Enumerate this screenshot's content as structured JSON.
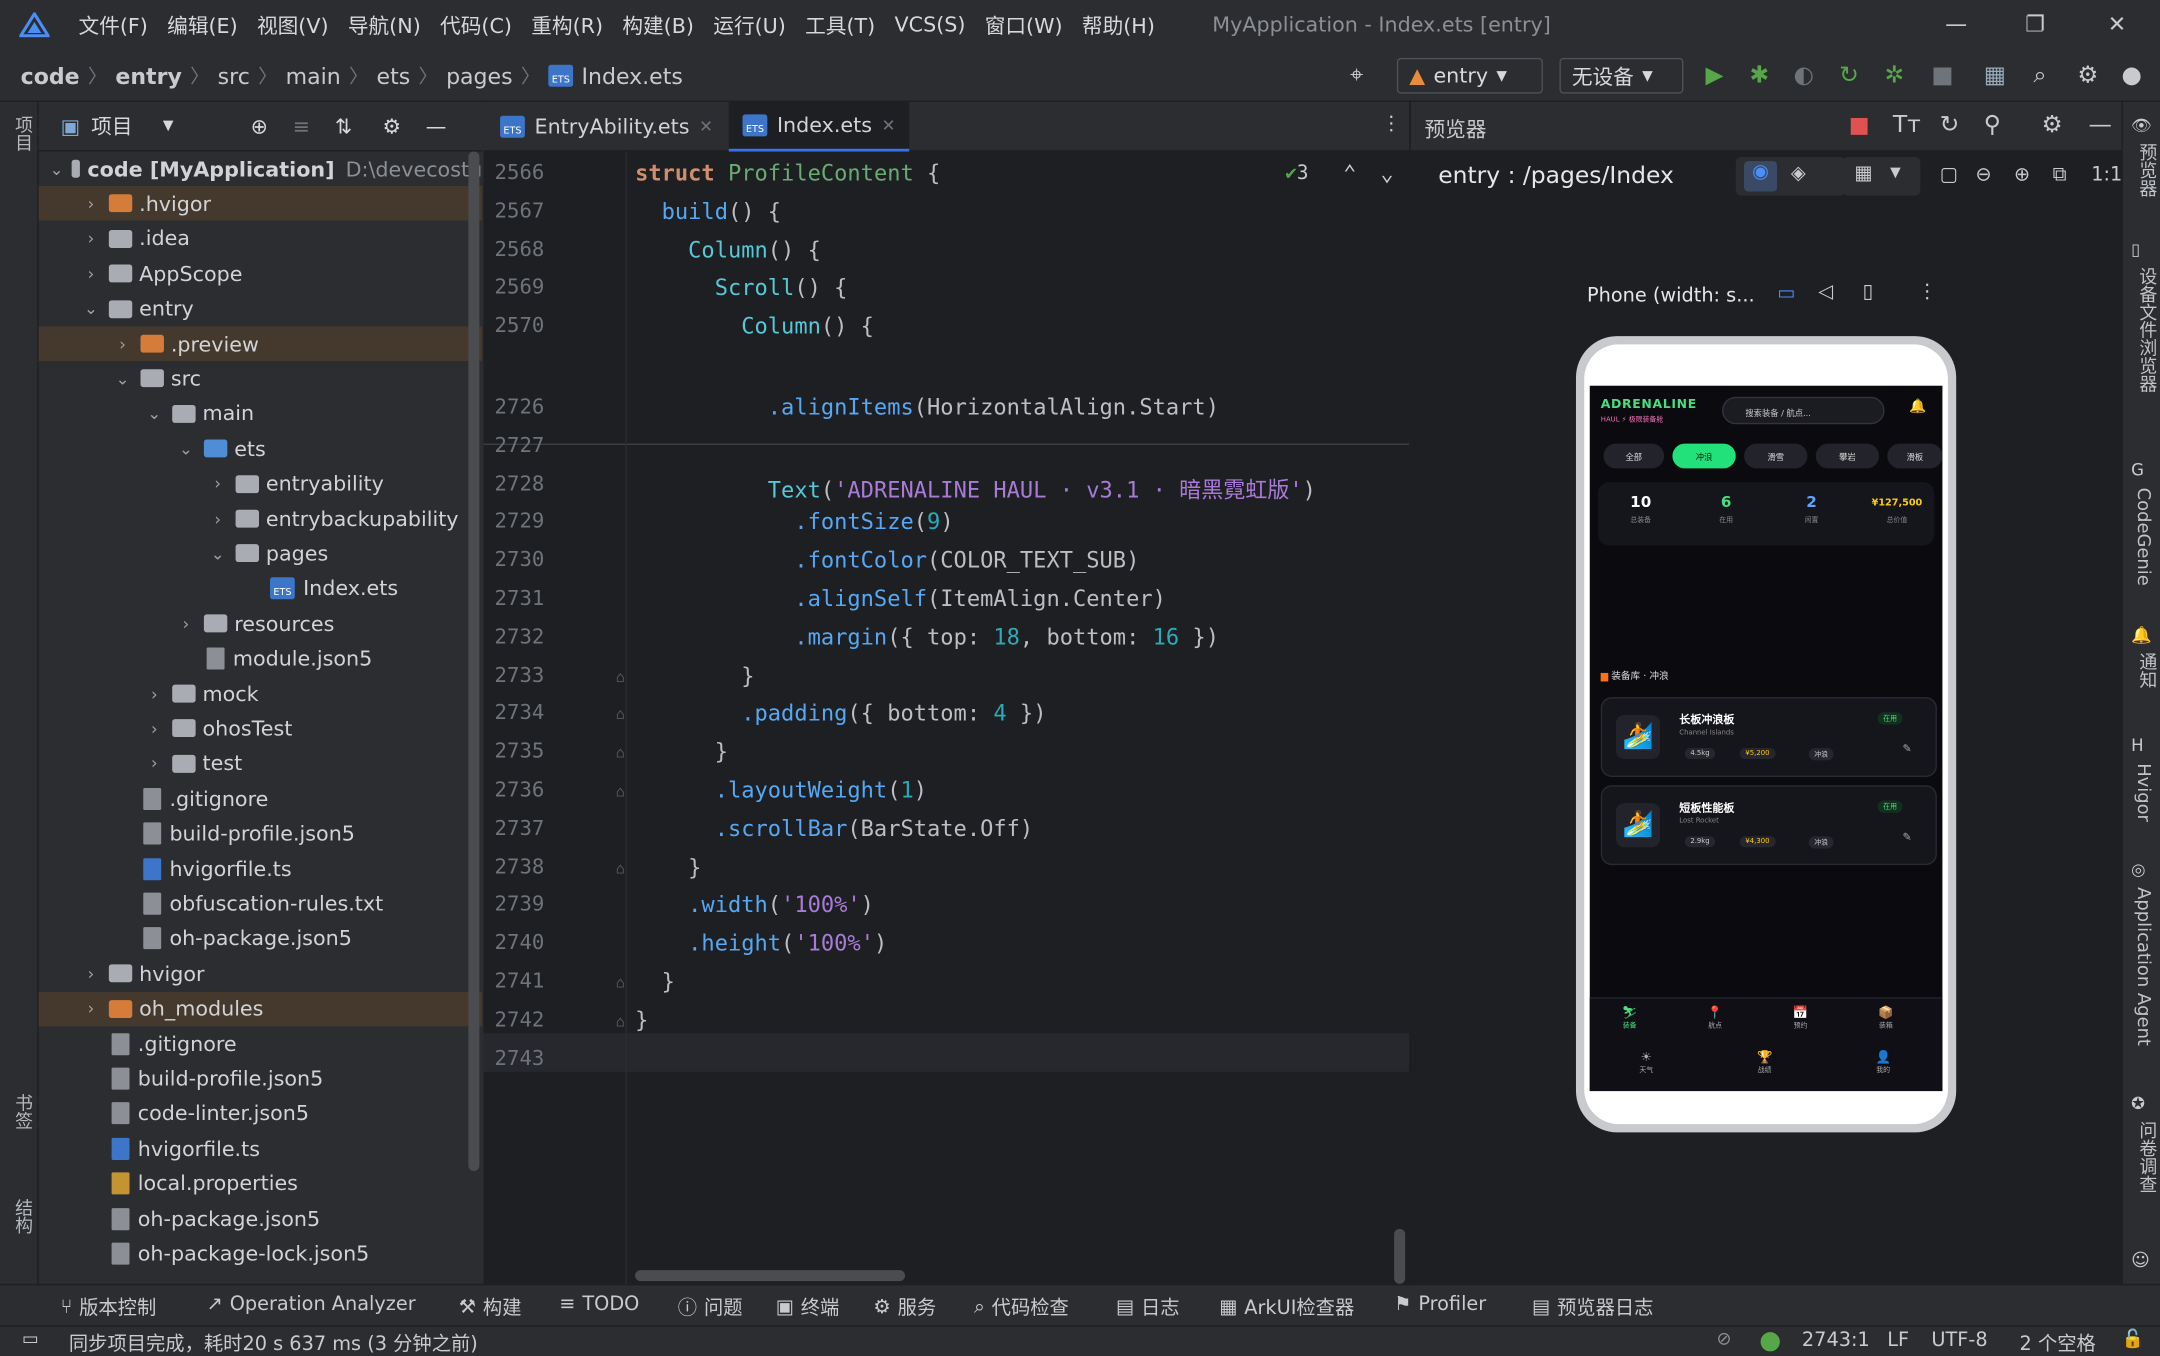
{
  "menu": [
    "文件(F)",
    "编辑(E)",
    "视图(V)",
    "导航(N)",
    "代码(C)",
    "重构(R)",
    "构建(B)",
    "运行(U)",
    "工具(T)",
    "VCS(S)",
    "窗口(W)",
    "帮助(H)"
  ],
  "window_title": "MyApplication - Index.ets [entry]",
  "breadcrumb": [
    "code",
    "entry",
    "src",
    "main",
    "ets",
    "pages",
    "Index.ets"
  ],
  "toolbar": {
    "module": "entry",
    "device": "无设备"
  },
  "left_strip": {
    "project": "项目",
    "bookmarks": "书签",
    "structure": "结构"
  },
  "project_panel": {
    "title": "项目"
  },
  "tree": [
    {
      "label": "code [MyApplication]",
      "extra": "D:\\devecostu",
      "depth": 0,
      "arrow": "v",
      "kind": "folder",
      "hl": false
    },
    {
      "label": ".hvigor",
      "depth": 1,
      "arrow": ">",
      "kind": "folder-o",
      "hl": true
    },
    {
      "label": ".idea",
      "depth": 1,
      "arrow": ">",
      "kind": "folder",
      "hl": false
    },
    {
      "label": "AppScope",
      "depth": 1,
      "arrow": ">",
      "kind": "folder",
      "hl": false
    },
    {
      "label": "entry",
      "depth": 1,
      "arrow": "v",
      "kind": "folder",
      "hl": false
    },
    {
      "label": ".preview",
      "depth": 2,
      "arrow": ">",
      "kind": "folder-o",
      "hl": true
    },
    {
      "label": "src",
      "depth": 2,
      "arrow": "v",
      "kind": "folder",
      "hl": false
    },
    {
      "label": "main",
      "depth": 3,
      "arrow": "v",
      "kind": "folder",
      "hl": false
    },
    {
      "label": "ets",
      "depth": 4,
      "arrow": "v",
      "kind": "folder-b",
      "hl": false
    },
    {
      "label": "entryability",
      "depth": 5,
      "arrow": ">",
      "kind": "folder",
      "hl": false
    },
    {
      "label": "entrybackupability",
      "depth": 5,
      "arrow": ">",
      "kind": "folder",
      "hl": false
    },
    {
      "label": "pages",
      "depth": 5,
      "arrow": "v",
      "kind": "folder",
      "hl": false
    },
    {
      "label": "Index.ets",
      "depth": 6,
      "arrow": "",
      "kind": "ets",
      "hl": false
    },
    {
      "label": "resources",
      "depth": 4,
      "arrow": ">",
      "kind": "folder",
      "hl": false
    },
    {
      "label": "module.json5",
      "depth": 4,
      "arrow": "",
      "kind": "file",
      "hl": false
    },
    {
      "label": "mock",
      "depth": 3,
      "arrow": ">",
      "kind": "folder",
      "hl": false
    },
    {
      "label": "ohosTest",
      "depth": 3,
      "arrow": ">",
      "kind": "folder",
      "hl": false
    },
    {
      "label": "test",
      "depth": 3,
      "arrow": ">",
      "kind": "folder",
      "hl": false
    },
    {
      "label": ".gitignore",
      "depth": 2,
      "arrow": "",
      "kind": "file",
      "hl": false
    },
    {
      "label": "build-profile.json5",
      "depth": 2,
      "arrow": "",
      "kind": "file",
      "hl": false
    },
    {
      "label": "hvigorfile.ts",
      "depth": 2,
      "arrow": "",
      "kind": "ts",
      "hl": false
    },
    {
      "label": "obfuscation-rules.txt",
      "depth": 2,
      "arrow": "",
      "kind": "file",
      "hl": false
    },
    {
      "label": "oh-package.json5",
      "depth": 2,
      "arrow": "",
      "kind": "file",
      "hl": false
    },
    {
      "label": "hvigor",
      "depth": 1,
      "arrow": ">",
      "kind": "folder",
      "hl": false
    },
    {
      "label": "oh_modules",
      "depth": 1,
      "arrow": ">",
      "kind": "folder-o",
      "hl": true
    },
    {
      "label": ".gitignore",
      "depth": 1,
      "arrow": "",
      "kind": "file",
      "hl": false
    },
    {
      "label": "build-profile.json5",
      "depth": 1,
      "arrow": "",
      "kind": "file",
      "hl": false
    },
    {
      "label": "code-linter.json5",
      "depth": 1,
      "arrow": "",
      "kind": "file",
      "hl": false
    },
    {
      "label": "hvigorfile.ts",
      "depth": 1,
      "arrow": "",
      "kind": "ts",
      "hl": false
    },
    {
      "label": "local.properties",
      "depth": 1,
      "arrow": "",
      "kind": "prop",
      "hl": false
    },
    {
      "label": "oh-package.json5",
      "depth": 1,
      "arrow": "",
      "kind": "file",
      "hl": false
    },
    {
      "label": "oh-package-lock.json5",
      "depth": 1,
      "arrow": "",
      "kind": "file",
      "hl": false
    }
  ],
  "editor_tabs": [
    {
      "label": "EntryAbility.ets",
      "active": false
    },
    {
      "label": "Index.ets",
      "active": true
    }
  ],
  "inspection_count": "3",
  "sticky": [
    {
      "n": "2566",
      "parts": [
        [
          "kw",
          "struct "
        ],
        [
          "ty",
          "ProfileContent "
        ],
        [
          "",
          "{"
        ]
      ]
    },
    {
      "n": "2567",
      "parts": [
        [
          "",
          ""
        ],
        [
          "fn",
          "build"
        ],
        [
          "",
          "() {"
        ]
      ],
      "indent": "  "
    },
    {
      "n": "2568",
      "parts": [
        [
          "cmp",
          "Column"
        ],
        [
          "",
          "() {"
        ]
      ],
      "indent": "    "
    },
    {
      "n": "2569",
      "parts": [
        [
          "cmp",
          "Scroll"
        ],
        [
          "",
          "() {"
        ]
      ],
      "indent": "      "
    },
    {
      "n": "2570",
      "parts": [
        [
          "cmp",
          "Column"
        ],
        [
          "",
          "() {"
        ]
      ],
      "indent": "        "
    }
  ],
  "code": [
    {
      "n": "2726",
      "text": "        .alignItems(HorizontalAlign.Start)",
      "parts": [
        [
          "",
          "          "
        ],
        [
          "fn",
          ".alignItems"
        ],
        [
          "",
          "(HorizontalAlign.Start)"
        ]
      ]
    },
    {
      "n": "2727",
      "parts": [
        [
          "",
          ""
        ]
      ]
    },
    {
      "n": "2728",
      "parts": [
        [
          "",
          "          "
        ],
        [
          "cmp",
          "Text"
        ],
        [
          "",
          "("
        ],
        [
          "str",
          "'ADRENALINE HAUL · v3.1 · 暗黑霓虹版'"
        ],
        [
          "",
          ")"
        ]
      ]
    },
    {
      "n": "2729",
      "parts": [
        [
          "",
          "            "
        ],
        [
          "fn",
          ".fontSize"
        ],
        [
          "",
          "("
        ],
        [
          "num",
          "9"
        ],
        [
          "",
          ")"
        ]
      ]
    },
    {
      "n": "2730",
      "parts": [
        [
          "",
          "            "
        ],
        [
          "fn",
          ".fontColor"
        ],
        [
          "",
          "(COLOR_TEXT_SUB)"
        ]
      ]
    },
    {
      "n": "2731",
      "parts": [
        [
          "",
          "            "
        ],
        [
          "fn",
          ".alignSelf"
        ],
        [
          "",
          "(ItemAlign.Center)"
        ]
      ]
    },
    {
      "n": "2732",
      "parts": [
        [
          "",
          "            "
        ],
        [
          "fn",
          ".margin"
        ],
        [
          "",
          "({ top: "
        ],
        [
          "num",
          "18"
        ],
        [
          "",
          ", bottom: "
        ],
        [
          "num",
          "16"
        ],
        [
          "",
          " })"
        ]
      ]
    },
    {
      "n": "2733",
      "parts": [
        [
          "",
          "        }"
        ]
      ]
    },
    {
      "n": "2734",
      "parts": [
        [
          "",
          "        "
        ],
        [
          "fn",
          ".padding"
        ],
        [
          "",
          "({ bottom: "
        ],
        [
          "num",
          "4"
        ],
        [
          "",
          " })"
        ]
      ]
    },
    {
      "n": "2735",
      "parts": [
        [
          "",
          "      }"
        ]
      ]
    },
    {
      "n": "2736",
      "parts": [
        [
          "",
          "      "
        ],
        [
          "fn",
          ".layoutWeight"
        ],
        [
          "",
          "("
        ],
        [
          "num",
          "1"
        ],
        [
          "",
          ")"
        ]
      ]
    },
    {
      "n": "2737",
      "parts": [
        [
          "",
          "      "
        ],
        [
          "fn",
          ".scrollBar"
        ],
        [
          "",
          "(BarState.Off)"
        ]
      ]
    },
    {
      "n": "2738",
      "parts": [
        [
          "",
          "    }"
        ]
      ]
    },
    {
      "n": "2739",
      "parts": [
        [
          "",
          "    "
        ],
        [
          "fn",
          ".width"
        ],
        [
          "",
          "("
        ],
        [
          "str",
          "'100%'"
        ],
        [
          "",
          ")"
        ]
      ]
    },
    {
      "n": "2740",
      "parts": [
        [
          "",
          "    "
        ],
        [
          "fn",
          ".height"
        ],
        [
          "",
          "("
        ],
        [
          "str",
          "'100%'"
        ],
        [
          "",
          ")"
        ]
      ]
    },
    {
      "n": "2741",
      "parts": [
        [
          "",
          "  }"
        ]
      ]
    },
    {
      "n": "2742",
      "parts": [
        [
          "",
          "}"
        ]
      ]
    },
    {
      "n": "2743",
      "parts": [
        [
          "",
          ""
        ]
      ]
    }
  ],
  "preview": {
    "title": "预览器",
    "route": "entry : /pages/Index",
    "device": "Phone (width: s..."
  },
  "app": {
    "brand": "ADRENALINE",
    "brand_sub": "HAUL ⚡ 极限装备舱",
    "search": "搜索装备 / 航点...",
    "chips": [
      "全部",
      "冲浪",
      "滑雪",
      "攀岩",
      "滑板"
    ],
    "stats": [
      {
        "v": "10",
        "l": "总装备",
        "c": "#ffffff"
      },
      {
        "v": "6",
        "l": "在用",
        "c": "#4ade80"
      },
      {
        "v": "2",
        "l": "闲置",
        "c": "#60a5fa"
      },
      {
        "v": "¥127,500",
        "l": "总价值",
        "c": "#facc15"
      }
    ],
    "section": "装备库 · 冲浪",
    "cards": [
      {
        "name": "长板冲浪板",
        "sub": "Channel Islands",
        "w": "4.5kg",
        "p": "¥5,200",
        "t": "冲浪",
        "s": "在用"
      },
      {
        "name": "短板性能板",
        "sub": "Lost Rocket",
        "w": "2.9kg",
        "p": "¥4,300",
        "t": "冲浪",
        "s": "在用"
      }
    ],
    "nav1": [
      "装备",
      "航点",
      "预约",
      "装箱"
    ],
    "nav2": [
      "天气",
      "战绩",
      "我的"
    ]
  },
  "right_strip": [
    "预览器",
    "设备文件浏览器",
    "CodeGenie",
    "通知",
    "Hvigor",
    "Application Agent",
    "问卷调查"
  ],
  "bottom_tools": [
    "版本控制",
    "Operation Analyzer",
    "构建",
    "TODO",
    "问题",
    "终端",
    "服务",
    "代码检查",
    "日志",
    "ArkUI检查器",
    "Profiler",
    "预览器日志"
  ],
  "status": {
    "msg": "同步项目完成，耗时20 s 637 ms (3 分钟之前)",
    "pos": "2743:1",
    "lf": "LF",
    "enc": "UTF-8",
    "indent": "2 个空格"
  }
}
